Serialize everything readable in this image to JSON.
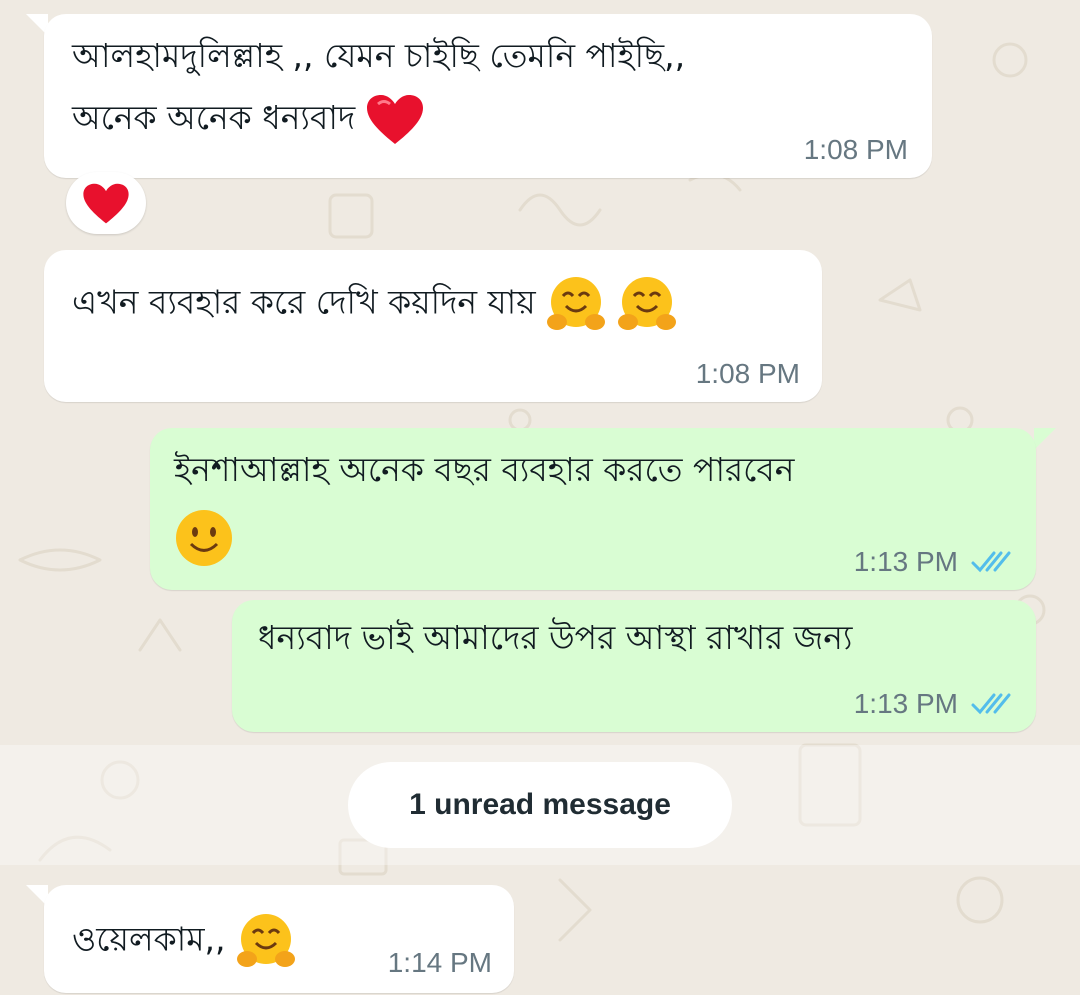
{
  "chat": {
    "messages": [
      {
        "direction": "incoming",
        "lines": [
          "আলহামদুলিল্লাহ ,, যেমন চাইছি তেমনি পাইছি,,",
          "অনেক অনেক ধন্যবাদ"
        ],
        "emoji": [
          "red-heart"
        ],
        "time": "1:08 PM",
        "reaction": "red-heart"
      },
      {
        "direction": "incoming",
        "lines": [
          "এখন ব্যবহার করে দেখি কয়দিন যায়"
        ],
        "emoji": [
          "hugging-face",
          "hugging-face"
        ],
        "time": "1:08 PM"
      },
      {
        "direction": "outgoing",
        "lines": [
          "ইনশাআল্লাহ অনেক বছর ব্যবহার করতে পারবেন"
        ],
        "emoji": [
          "smiling-face"
        ],
        "time": "1:13 PM",
        "status": "read"
      },
      {
        "direction": "outgoing",
        "lines": [
          "ধন্যবাদ ভাই আমাদের উপর আস্থা রাখার জন্য"
        ],
        "time": "1:13 PM",
        "status": "read"
      },
      {
        "direction": "incoming",
        "lines": [
          "ওয়েলকাম,,"
        ],
        "emoji": [
          "hugging-face"
        ],
        "time": "1:14 PM"
      }
    ],
    "unread_label": "1 unread message"
  },
  "colors": {
    "wallpaper": "#efeae2",
    "incoming_bubble": "#ffffff",
    "outgoing_bubble": "#d9fdd3",
    "timestamp": "#667781",
    "read_ticks": "#53bdeb",
    "heart": "#e8112d"
  }
}
